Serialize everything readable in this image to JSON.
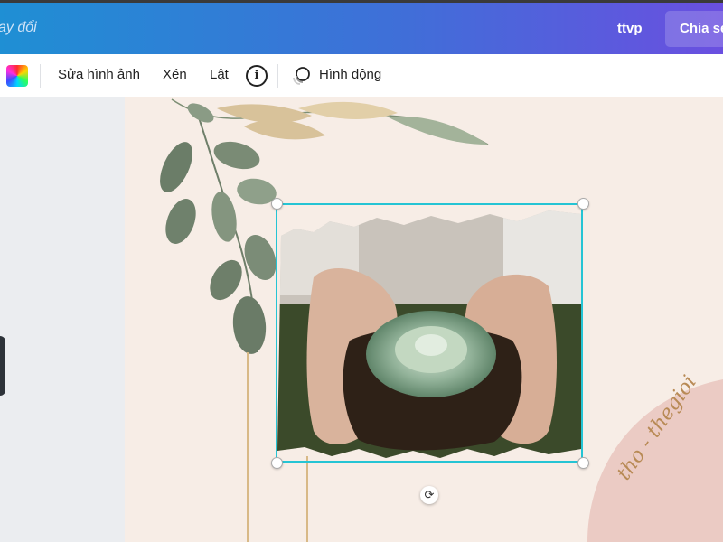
{
  "topbar": {
    "saved_status": "ay đổi",
    "user_name": "ttvp",
    "share_label": "Chia sẻ"
  },
  "toolbar": {
    "edit_image": "Sửa hình ảnh",
    "crop": "Xén",
    "flip": "Lật",
    "info_glyph": "i",
    "animate": "Hình động"
  },
  "canvas": {
    "handwriting_text": "tho - thegioi"
  },
  "icons": {
    "color": "color-picker-icon",
    "info": "info-icon",
    "animate": "animate-icon",
    "rotate": "rotate-icon"
  },
  "colors": {
    "selection": "#25c4d4",
    "canvas_bg": "#f7ede6",
    "topbar_start": "#1f8fd4",
    "topbar_end": "#6a4fe0"
  }
}
